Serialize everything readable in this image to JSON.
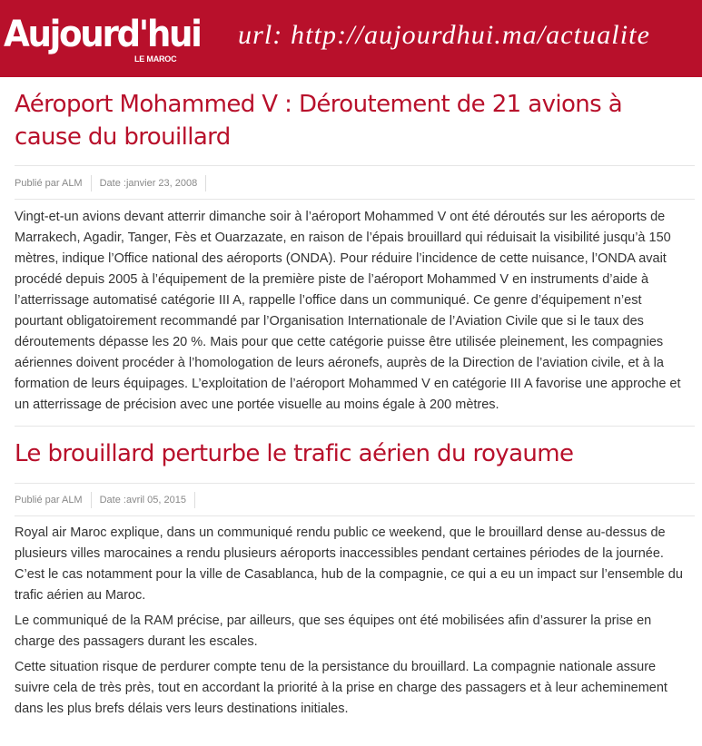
{
  "header": {
    "logo_text": "Aujourd'hui",
    "logo_subtext": "LE MAROC",
    "url_label": "url: http://aujourdhui.ma/actualite",
    "bg_color": "#b8102b"
  },
  "articles": [
    {
      "title": "Aéroport Mohammed V : Déroutement de 21 avions à cause du brouillard",
      "author": "Publié par ALM",
      "date": "Date :janvier 23, 2008",
      "paragraphs": [
        "Vingt-et-un avions devant atterrir dimanche soir à l’aéroport Mohammed V ont été déroutés sur les aéroports de Marrakech, Agadir, Tanger, Fès et Ouarzazate, en raison de l’épais brouillard qui réduisait la visibilité jusqu’à 150 mètres, indique l’Office national des aéroports (ONDA). Pour réduire l’incidence de cette nuisance, l’ONDA avait procédé depuis 2005 à l’équipement de la première piste de l’aéroport Mohammed V en instruments d’aide à l’atterrissage automatisé catégorie III A, rappelle l’office dans un communiqué. Ce genre d’équipement n’est pourtant obligatoirement recommandé par l’Organisation Internationale de l’Aviation Civile que si le taux des déroutements dépasse les 20 %. Mais pour que cette catégorie puisse être utilisée pleinement, les compagnies aériennes doivent procéder à l’homologation de leurs aéronefs, auprès de la Direction de l’aviation civile, et à la formation de leurs équipages. L’exploitation de l’aéroport Mohammed V en catégorie III A favorise une approche et un atterrissage de précision avec une portée visuelle au moins égale à 200 mètres."
      ]
    },
    {
      "title": "Le brouillard perturbe le trafic aérien du royaume",
      "author": "Publié par ALM",
      "date": "Date :avril 05, 2015",
      "paragraphs": [
        "Royal air Maroc explique, dans un communiqué rendu public ce weekend, que le brouillard dense au-dessus de plusieurs villes marocaines a rendu plusieurs aéroports inaccessibles pendant certaines périodes de la journée. C’est le cas notamment pour la ville de Casablanca, hub de la compagnie, ce qui a eu un impact sur l’ensemble du trafic aérien au Maroc.",
        "Le communiqué de la RAM précise, par ailleurs, que ses équipes ont été mobilisées afin d’assurer la prise en charge des passagers durant les escales.",
        "Cette situation risque de perdurer compte tenu de la persistance du brouillard. La compagnie nationale assure suivre cela de très près, tout en accordant la priorité à la prise en charge des passagers et à leur acheminement dans les plus brefs délais vers leurs destinations initiales."
      ]
    }
  ]
}
